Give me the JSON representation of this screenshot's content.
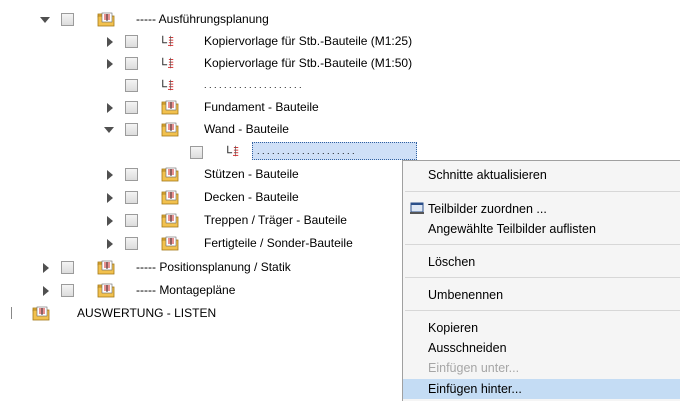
{
  "tree": {
    "ausfuehrung": "----- Ausführungsplanung",
    "kopier25": "Kopiervorlage für Stb.-Bauteile (M1:25)",
    "kopier50": "Kopiervorlage für Stb.-Bauteile (M1:50)",
    "dots1": ". . . . . . . . . . . . . . . . . . . .",
    "fundament": "Fundament - Bauteile",
    "wand": "Wand - Bauteile",
    "dots2": ". . . . . . . . . . . . . . . . . . . .",
    "stuetzen": "Stützen - Bauteile",
    "decken": "Decken - Bauteile",
    "treppen": "Treppen / Träger - Bauteile",
    "fertigteile": "Fertigteile / Sonder-Bauteile",
    "position": "----- Positionsplanung / Statik",
    "montage": "----- Montagepläne",
    "auswertung": "AUSWERTUNG - LISTEN"
  },
  "menu": {
    "schnitte": "Schnitte aktualisieren",
    "teilbilder_zuordnen": "Teilbilder zuordnen ...",
    "angewaehlte": "Angewählte Teilbilder auflisten",
    "loeschen": "Löschen",
    "umbenennen": "Umbenennen",
    "kopieren": "Kopieren",
    "ausschneiden": "Ausschneiden",
    "einfuegen_unter": "Einfügen unter...",
    "einfuegen_hinter": "Einfügen hinter..."
  },
  "colors": {
    "highlight": "#c4dcf4",
    "selection": "#cfe0f7",
    "disabled": "#a6a6a6"
  }
}
